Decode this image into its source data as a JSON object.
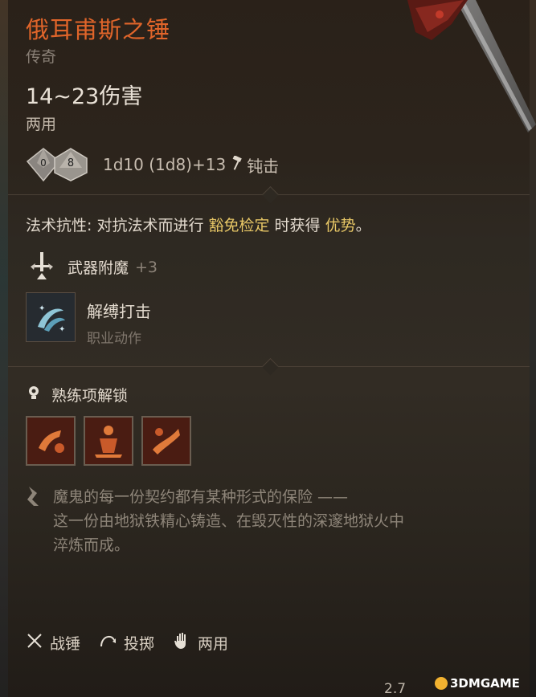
{
  "item": {
    "name": "俄耳甫斯之锤",
    "rarity": "传奇",
    "damage": "14~23伤害",
    "handedness": "两用",
    "dice": {
      "die1": "0",
      "die2": "8"
    },
    "damage_formula": "1d10 (1d8)+13",
    "damage_type": "钝击"
  },
  "properties": {
    "resistance_prefix": "法术抗性: 对抗法术而进行 ",
    "resistance_save": "豁免检定",
    "resistance_mid": " 时获得 ",
    "resistance_adv": "优势",
    "resistance_end": "。",
    "enchant_label": "武器附魔",
    "enchant_value": "+3"
  },
  "action": {
    "name": "解缚打击",
    "type": "职业动作"
  },
  "proficiency": {
    "label": "熟练项解锁",
    "icons": [
      "tenacity-icon",
      "topple-icon",
      "rush-attack-icon"
    ]
  },
  "description": {
    "line1": "魔鬼的每一份契约都有某种形式的保险 ——",
    "line2": "这一份由地狱铁精心铸造、在毁灭性的深邃地狱火中",
    "line3": "淬炼而成。"
  },
  "tags": {
    "type": "战锤",
    "thrown": "投掷",
    "hands": "两用"
  },
  "footer": {
    "weight": "2.7",
    "watermark": "3DMGAME"
  },
  "colors": {
    "legendary": "#e0652a",
    "highlight": "#e8c766"
  }
}
